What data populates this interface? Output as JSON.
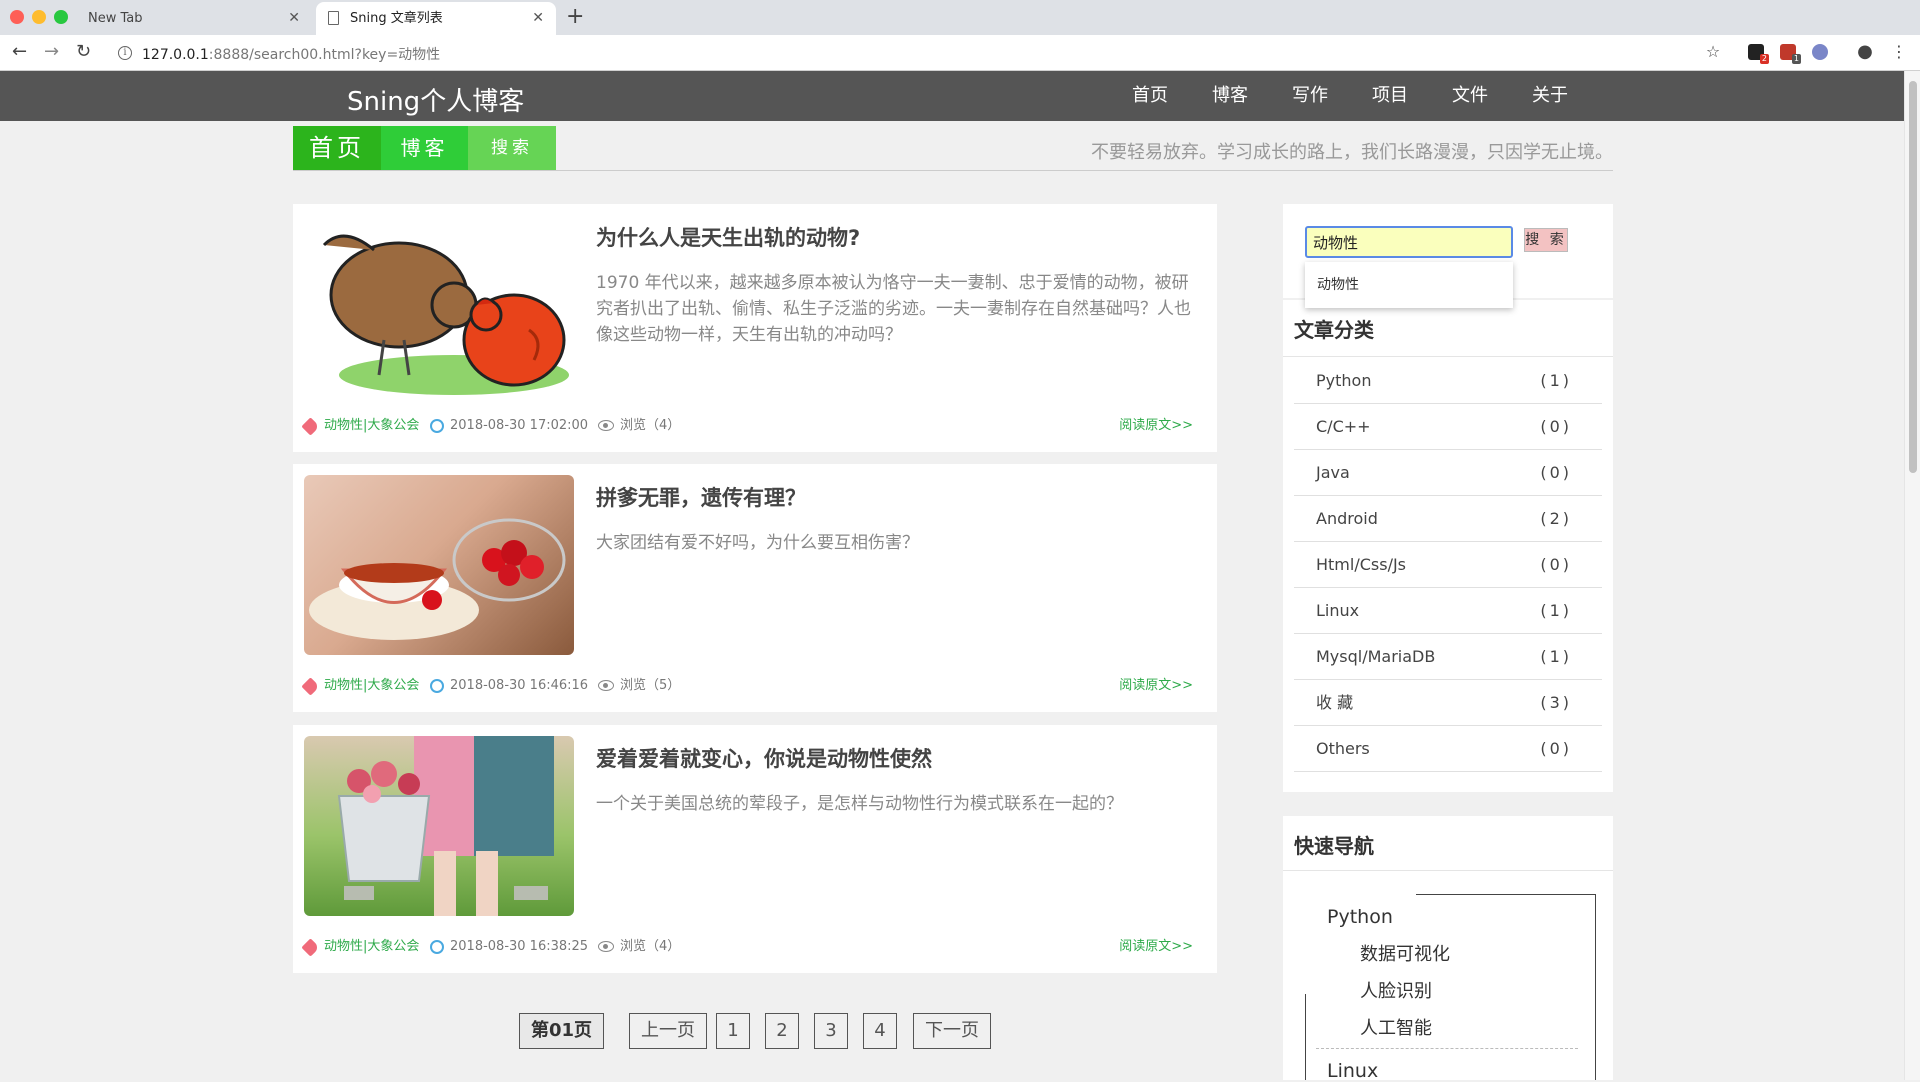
{
  "browser": {
    "tabs": [
      {
        "title": "New Tab",
        "active": false
      },
      {
        "title": "Sning 文章列表",
        "active": true
      }
    ],
    "url_host": "127.0.0.1",
    "url_rest": ":8888/search00.html?key=动物性",
    "ext_badges": [
      "2",
      "1"
    ]
  },
  "site": {
    "logo": "Sning个人博客",
    "nav": [
      "首页",
      "博客",
      "写作",
      "项目",
      "文件",
      "关于"
    ],
    "subnav": [
      "首页",
      "博客",
      "搜索"
    ],
    "motto": "不要轻易放弃。学习成长的路上，我们长路漫漫，只因学无止境。"
  },
  "articles": [
    {
      "title": "为什么人是天生出轨的动物?",
      "desc": "1970 年代以来，越来越多原本被认为恪守一夫一妻制、忠于爱情的动物，被研究者扒出了出轨、偷情、私生子泛滥的劣迹。一夫一妻制存在自然基础吗？人也像这些动物一样，天生有出轨的冲动吗？",
      "tag": "动物性|大象公会",
      "date": "2018-08-30 17:02:00",
      "views": "浏览（4）",
      "readmore": "阅读原文>>"
    },
    {
      "title": "拼爹无罪，遗传有理？",
      "desc": "大家团结有爱不好吗，为什么要互相伤害？",
      "tag": "动物性|大象公会",
      "date": "2018-08-30 16:46:16",
      "views": "浏览（5）",
      "readmore": "阅读原文>>"
    },
    {
      "title": "爱着爱着就变心，你说是动物性使然",
      "desc": "一个关于美国总统的荤段子，是怎样与动物性行为模式联系在一起的？",
      "tag": "动物性|大象公会",
      "date": "2018-08-30 16:38:25",
      "views": "浏览（4）",
      "readmore": "阅读原文>>"
    }
  ],
  "pagination": {
    "current": "第01页",
    "prev": "上一页",
    "pages": [
      "1",
      "2",
      "3",
      "4"
    ],
    "next": "下一页"
  },
  "sidebar": {
    "search_value": "动物性",
    "search_button": "搜 索",
    "suggestion": "动物性",
    "categories_title": "文章分类",
    "categories": [
      {
        "name": "Python",
        "count": "(1)"
      },
      {
        "name": "C/C++",
        "count": "(0)"
      },
      {
        "name": "Java",
        "count": "(0)"
      },
      {
        "name": "Android",
        "count": "(2)"
      },
      {
        "name": "Html/Css/Js",
        "count": "(0)"
      },
      {
        "name": "Linux",
        "count": "(1)"
      },
      {
        "name": "Mysql/MariaDB",
        "count": "(1)"
      },
      {
        "name": "收 藏",
        "count": "(3)"
      },
      {
        "name": "Others",
        "count": "(0)"
      }
    ],
    "quicknav_title": "快速导航",
    "quicknav": [
      {
        "group": "Python",
        "items": [
          "数据可视化",
          "人脸识别",
          "人工智能"
        ]
      },
      {
        "group": "Linux",
        "items": []
      }
    ]
  },
  "colors": {
    "header_bg": "#555555",
    "subnav_1": "#2cb41c",
    "subnav_2": "#2fcd38",
    "subnav_3": "#66d455",
    "tag_green": "#2eaa4a"
  }
}
